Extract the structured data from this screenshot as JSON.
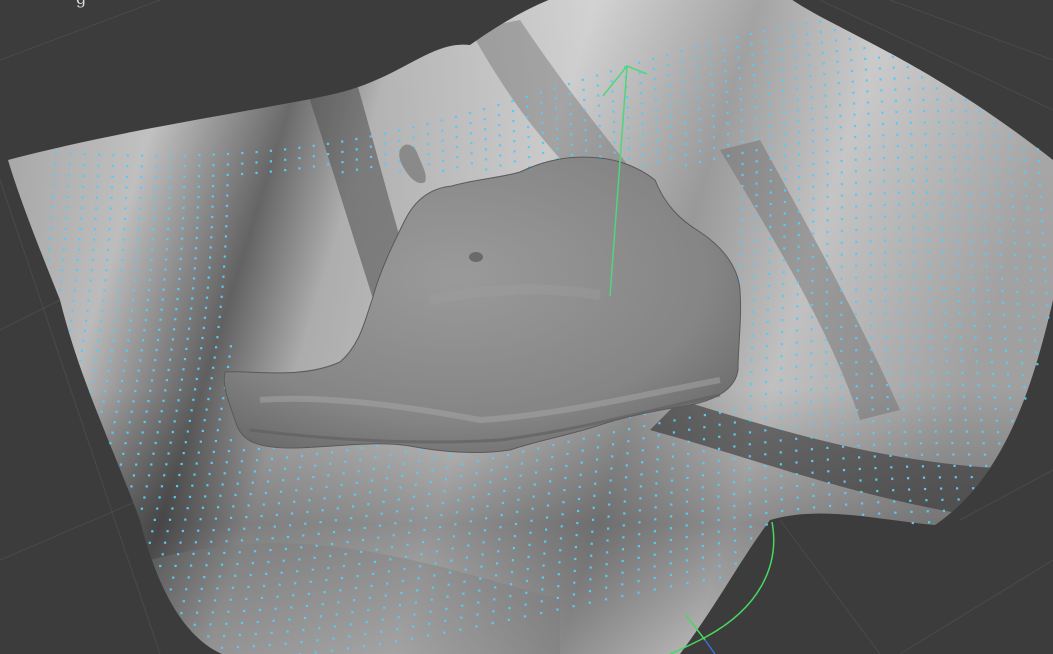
{
  "viewport": {
    "corner_label": "g"
  },
  "colors": {
    "background": "#3c3c3c",
    "grid_line": "#4d4d4d",
    "surface_light": "#c2c2c2",
    "surface_dark": "#5e5e5e",
    "mesh_point": "#5ec8f0",
    "object": "#8a8a8a",
    "axis_y": "#4fd67a",
    "rotation_ring": "#48d860",
    "axis_z": "#3a6fd8"
  },
  "icons": {
    "move_gizmo": "arrow-up-icon",
    "rotate_gizmo": "rotation-ring-icon"
  }
}
